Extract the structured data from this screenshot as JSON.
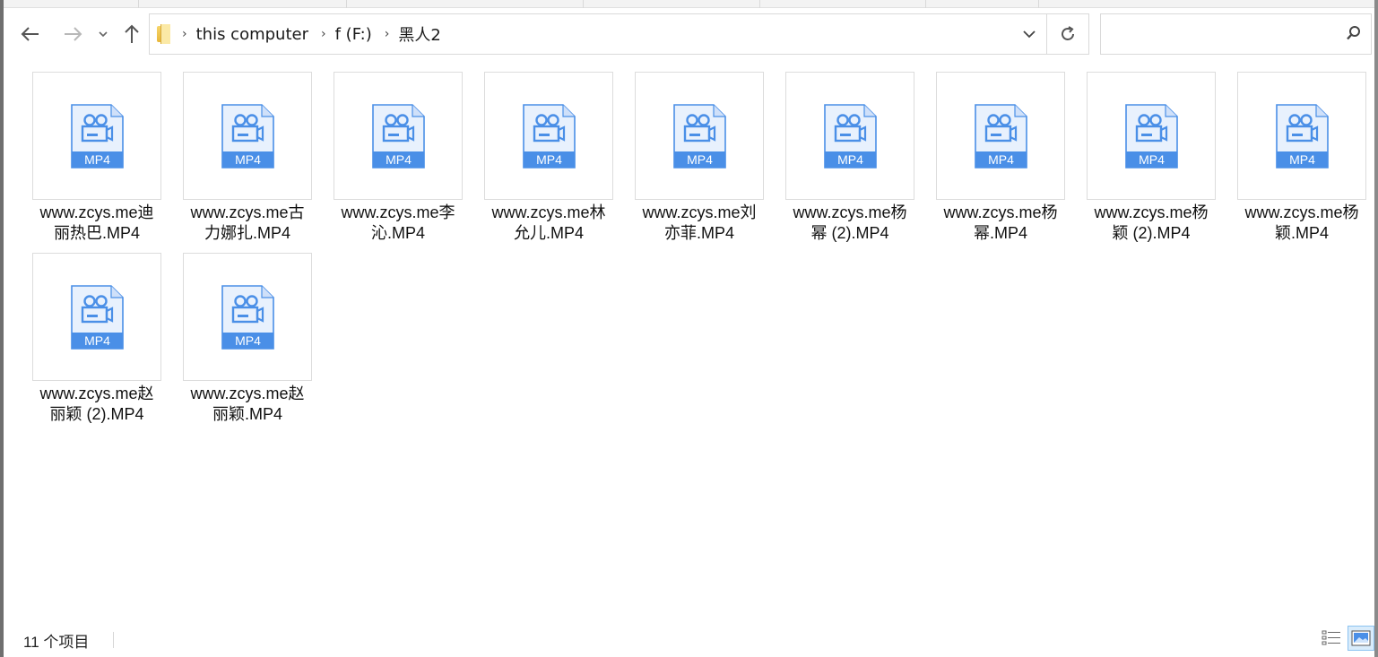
{
  "nav": {
    "back_icon": "back-arrow-icon",
    "forward_icon": "forward-arrow-icon",
    "recent_icon": "chevron-down-icon",
    "up_icon": "up-arrow-icon"
  },
  "address": {
    "crumbs": [
      "this computer",
      "f (F:)",
      "黑人2"
    ],
    "dropdown_icon": "chevron-down-icon",
    "refresh_icon": "refresh-icon"
  },
  "search": {
    "placeholder": "",
    "icon": "search-icon"
  },
  "files": [
    {
      "name_line1": "www.zcys.me迪",
      "name_line2": "丽热巴.MP4",
      "badge": "MP4"
    },
    {
      "name_line1": "www.zcys.me古",
      "name_line2": "力娜扎.MP4",
      "badge": "MP4"
    },
    {
      "name_line1": "www.zcys.me李",
      "name_line2": "沁.MP4",
      "badge": "MP4"
    },
    {
      "name_line1": "www.zcys.me林",
      "name_line2": "允儿.MP4",
      "badge": "MP4"
    },
    {
      "name_line1": "www.zcys.me刘",
      "name_line2": "亦菲.MP4",
      "badge": "MP4"
    },
    {
      "name_line1": "www.zcys.me杨",
      "name_line2": "幂 (2).MP4",
      "badge": "MP4"
    },
    {
      "name_line1": "www.zcys.me杨",
      "name_line2": "幂.MP4",
      "badge": "MP4"
    },
    {
      "name_line1": "www.zcys.me杨",
      "name_line2": "颖 (2).MP4",
      "badge": "MP4"
    },
    {
      "name_line1": "www.zcys.me杨",
      "name_line2": "颖.MP4",
      "badge": "MP4"
    },
    {
      "name_line1": "www.zcys.me赵",
      "name_line2": "丽颖 (2).MP4",
      "badge": "MP4"
    },
    {
      "name_line1": "www.zcys.me赵",
      "name_line2": "丽颖.MP4",
      "badge": "MP4"
    }
  ],
  "status": {
    "count": "11 个项目",
    "details_view_icon": "details-view-icon",
    "large_icons_view_icon": "large-icons-view-icon"
  },
  "colors": {
    "file_icon_blue": "#4a8fe7",
    "file_icon_light": "#e8f1fd",
    "selected_view_bg": "#d9ecfb"
  }
}
